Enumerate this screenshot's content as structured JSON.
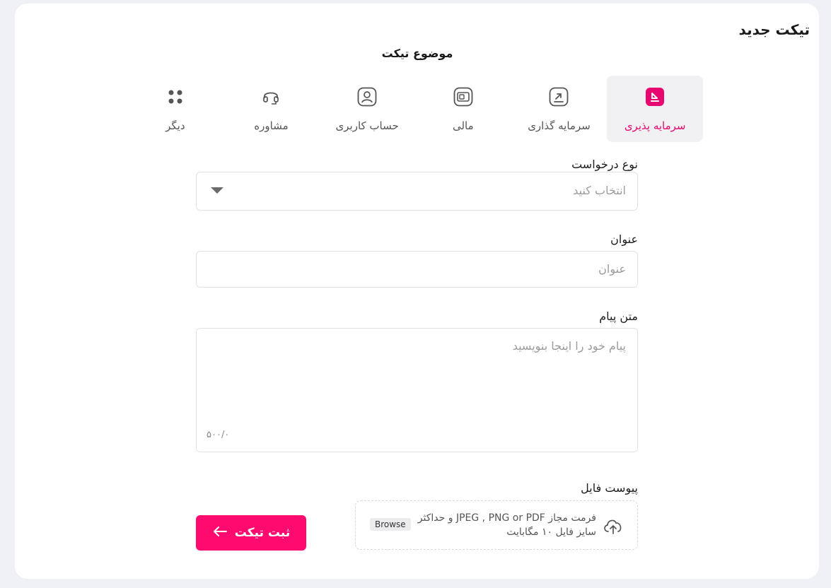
{
  "page": {
    "title": "تیکت جدید",
    "subject_title": "موضوع تیکت"
  },
  "categories": [
    {
      "label": "سرمایه پذیری",
      "icon": "download-box-icon",
      "active": true
    },
    {
      "label": "سرمایه گذاری",
      "icon": "arrow-up-right-box-icon",
      "active": false
    },
    {
      "label": "مالی",
      "icon": "wallet-icon",
      "active": false
    },
    {
      "label": "حساب کاربری",
      "icon": "user-icon",
      "active": false
    },
    {
      "label": "مشاوره",
      "icon": "headset-icon",
      "active": false
    },
    {
      "label": "دیگر",
      "icon": "grid-dots-icon",
      "active": false
    }
  ],
  "form": {
    "request_type": {
      "label": "نوع درخواست",
      "placeholder": "انتخاب کنید"
    },
    "title": {
      "label": "عنوان",
      "placeholder": "عنوان"
    },
    "message": {
      "label": "متن پیام",
      "placeholder": "پیام خود را اینجا بنویسید",
      "counter": "۵۰۰/۰"
    },
    "attachment": {
      "label": "پیوست فایل",
      "hint_line1": "فرمت مجاز JPEG , PNG or PDF و حداکثر",
      "hint_line2": "سایز فایل ۱۰ مگابایت",
      "browse_label": "Browse"
    },
    "submit_label": "ثبت تیکت"
  },
  "colors": {
    "accent": "#ff0a6f",
    "active_bg": "#f1f1f4",
    "background": "#f0f1f6"
  }
}
